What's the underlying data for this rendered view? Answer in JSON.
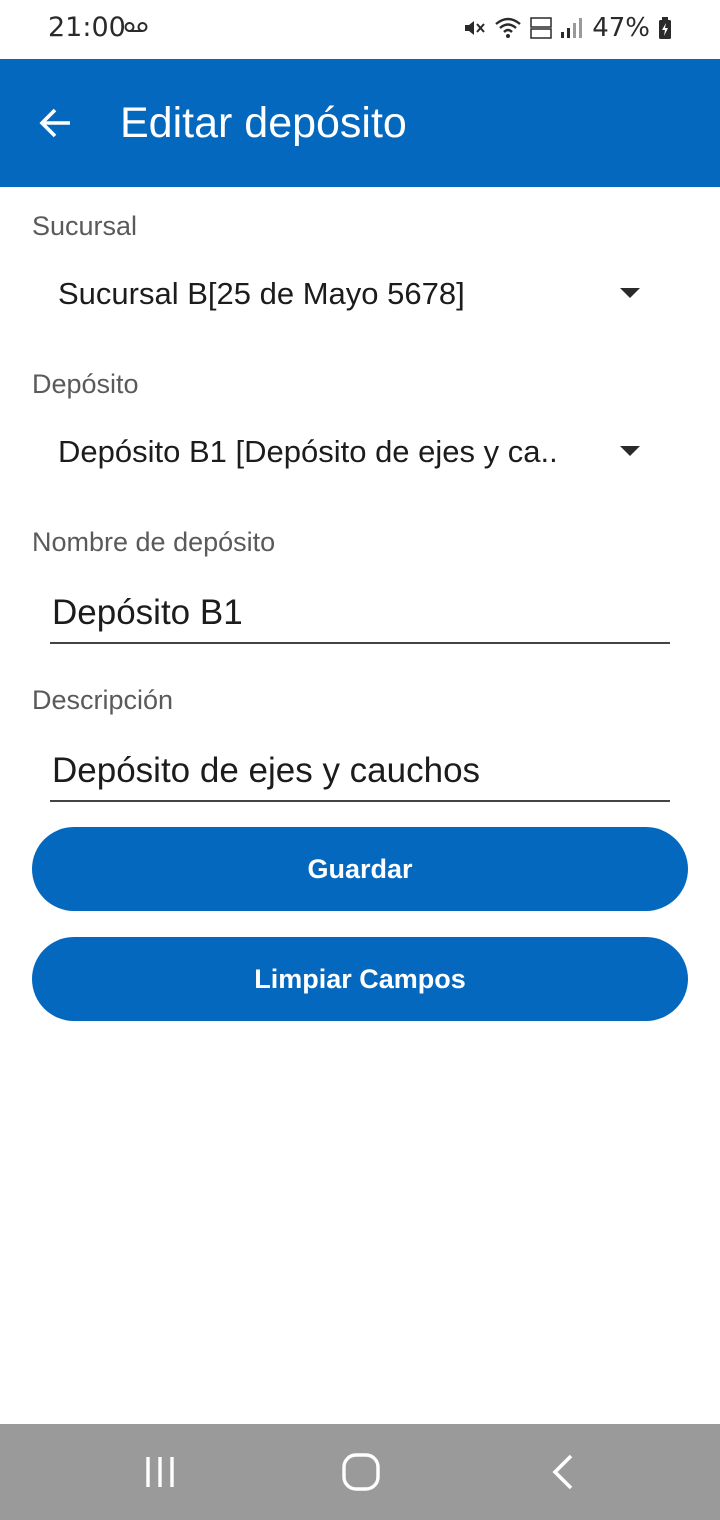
{
  "status_bar": {
    "time": "21:00",
    "battery": "47%",
    "icons": [
      "voicemail-icon",
      "mute-icon",
      "wifi-icon",
      "volte-icon",
      "signal-icon",
      "battery-icon"
    ]
  },
  "app_bar": {
    "title": "Editar depósito",
    "back_icon": "arrow-left-icon",
    "background": "#0468bf"
  },
  "form": {
    "sucursal": {
      "label": "Sucursal",
      "value": "Sucursal B[25 de Mayo 5678]"
    },
    "deposito": {
      "label": "Depósito",
      "value": "Depósito B1 [Depósito de ejes y ca.."
    },
    "nombre": {
      "label": "Nombre de depósito",
      "value": "Depósito B1"
    },
    "descripcion": {
      "label": "Descripción",
      "value": "Depósito de ejes y cauchos"
    }
  },
  "buttons": {
    "save_label": "Guardar",
    "clear_label": "Limpiar Campos"
  },
  "nav_bar": {
    "icons": [
      "recent-apps-icon",
      "home-icon",
      "back-icon"
    ]
  }
}
